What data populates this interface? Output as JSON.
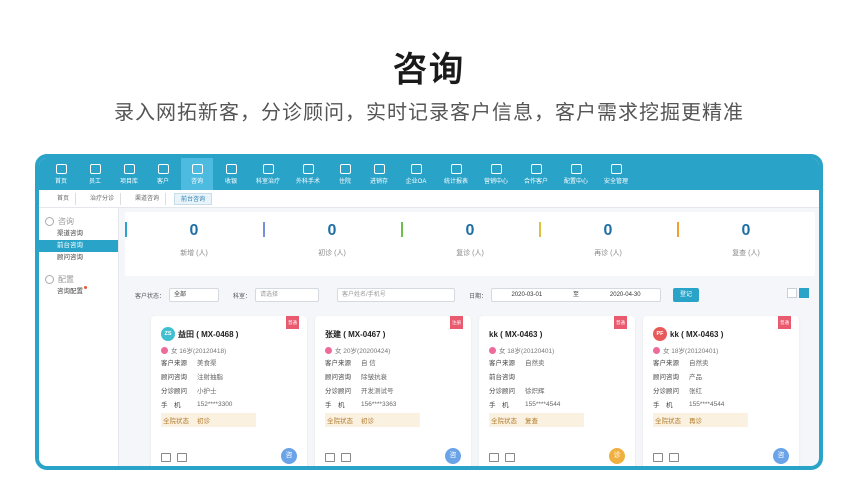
{
  "hero": {
    "title": "咨询",
    "subtitle": "录入网拓新客，分诊顾问，实时记录客户信息，客户需求挖掘更精准"
  },
  "colors": {
    "accent": "#2aa3c9",
    "tag": "#e95a6f",
    "number": "#1f6fa5"
  },
  "nav": [
    {
      "label": "首页",
      "icon": "home-icon"
    },
    {
      "label": "员工",
      "icon": "staff-icon"
    },
    {
      "label": "项目库",
      "icon": "project-icon"
    },
    {
      "label": "客户",
      "icon": "customer-icon"
    },
    {
      "label": "咨询",
      "icon": "consult-icon"
    },
    {
      "label": "收银",
      "icon": "cashier-icon"
    },
    {
      "label": "科室治疗",
      "icon": "treatment-icon"
    },
    {
      "label": "外科手术",
      "icon": "surgery-icon"
    },
    {
      "label": "住院",
      "icon": "hospital-icon"
    },
    {
      "label": "进销存",
      "icon": "inventory-icon"
    },
    {
      "label": "企业OA",
      "icon": "oa-icon"
    },
    {
      "label": "统计报表",
      "icon": "report-icon"
    },
    {
      "label": "营销中心",
      "icon": "marketing-icon"
    },
    {
      "label": "合作客户",
      "icon": "partner-icon"
    },
    {
      "label": "配置中心",
      "icon": "config-icon"
    },
    {
      "label": "安全管理",
      "icon": "security-icon"
    }
  ],
  "breadcrumbs": [
    "首页",
    "治疗分诊",
    "渠道咨询",
    "前台咨询"
  ],
  "sidebar": {
    "groups": [
      {
        "title": "咨询",
        "items": [
          "渠道咨询",
          "前台咨询",
          "顾问咨询"
        ]
      },
      {
        "title": "配置",
        "items": [
          "咨询配置"
        ]
      }
    ]
  },
  "stats": [
    {
      "value": "0",
      "label": "新增 (人)",
      "color": "#2aa3c9"
    },
    {
      "value": "0",
      "label": "初诊 (人)",
      "color": "#7b8fe0"
    },
    {
      "value": "0",
      "label": "复诊 (人)",
      "color": "#6cc04a"
    },
    {
      "value": "0",
      "label": "再诊 (人)",
      "color": "#e0c040"
    },
    {
      "value": "0",
      "label": "复查 (人)",
      "color": "#f0a030"
    }
  ],
  "filter": {
    "status_label": "客户状态：",
    "status_value": "全部",
    "dept_label": "科室：",
    "dept_placeholder": "请选择",
    "search_placeholder": "客户姓名/手机号",
    "date_label": "日期：",
    "date_from": "2020-03-01",
    "date_sep": "至",
    "date_to": "2020-04-30",
    "register_button": "登记"
  },
  "cards": [
    {
      "tag": "普通",
      "avatar": "ZS",
      "avatar_color": "#3fbfd0",
      "name": "益田 ( MX-0468 )",
      "meta": "女 16岁(20120418)",
      "rows": [
        {
          "k": "客户来源",
          "v": "美食渠"
        },
        {
          "k": "顾问咨询",
          "v": "注射抽脂"
        },
        {
          "k": "分诊顾问",
          "v": "小护士"
        },
        {
          "k": "手　机",
          "v": "152****3300"
        }
      ],
      "status": {
        "k": "全院状态",
        "v": "初诊"
      },
      "fab": "咨",
      "fab_color": "#6aa3e8"
    },
    {
      "tag": "注册",
      "avatar": "",
      "avatar_color": "",
      "name": "张建 ( MX-0467 )",
      "meta": "女 20岁(20200424)",
      "rows": [
        {
          "k": "客户来源",
          "v": "自 信"
        },
        {
          "k": "顾问咨询",
          "v": "除皱抗衰"
        },
        {
          "k": "分诊顾问",
          "v": "开发测试号"
        },
        {
          "k": "手　机",
          "v": "156****3363"
        }
      ],
      "status": {
        "k": "全院状态",
        "v": "初诊"
      },
      "fab": "咨",
      "fab_color": "#6aa3e8"
    },
    {
      "tag": "普通",
      "avatar": "",
      "avatar_color": "",
      "name": "kk ( MX-0463 )",
      "meta": "女 18岁(20120401)",
      "rows": [
        {
          "k": "客户来源",
          "v": "自然卖"
        },
        {
          "k": "前台咨询",
          "v": ""
        },
        {
          "k": "分诊顾问",
          "v": "徐炽辉"
        },
        {
          "k": "手　机",
          "v": "155****4544"
        }
      ],
      "status": {
        "k": "全院状态",
        "v": "复查"
      },
      "fab": "诊",
      "fab_color": "#f0b040"
    },
    {
      "tag": "普通",
      "avatar": "PF",
      "avatar_color": "#e85a5a",
      "name": "kk ( MX-0463 )",
      "meta": "女 18岁(20120401)",
      "rows": [
        {
          "k": "客户来源",
          "v": "自然卖"
        },
        {
          "k": "顾问咨询",
          "v": "产品"
        },
        {
          "k": "分诊顾问",
          "v": "张红"
        },
        {
          "k": "手　机",
          "v": "155****4544"
        }
      ],
      "status": {
        "k": "全院状态",
        "v": "再诊"
      },
      "fab": "咨",
      "fab_color": "#6aa3e8"
    }
  ]
}
